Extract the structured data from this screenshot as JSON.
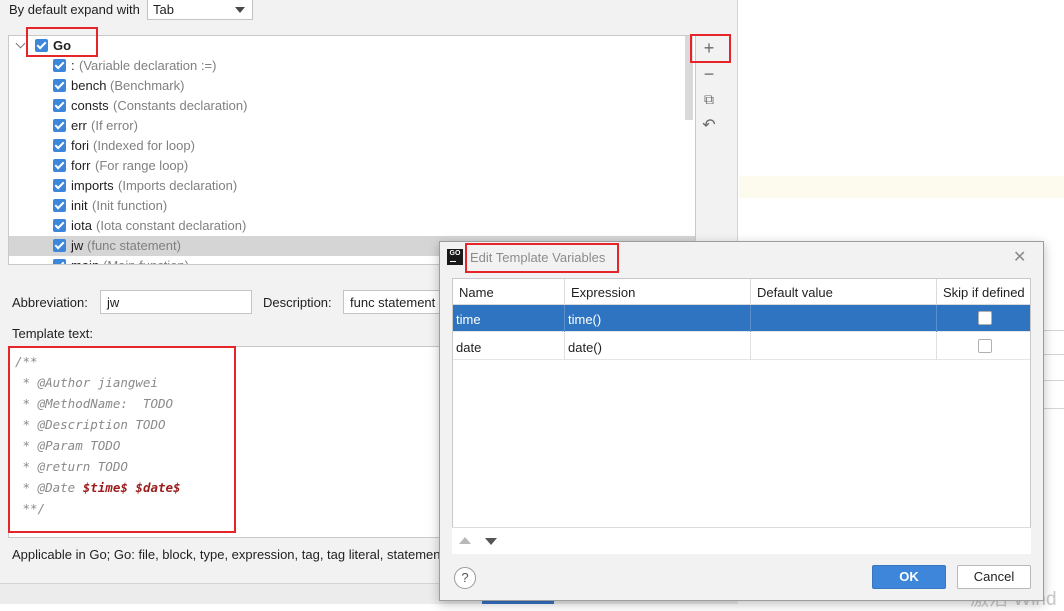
{
  "settings": {
    "expand_label": "By default expand with",
    "expand_value": "Tab",
    "group": {
      "name": "Go"
    },
    "templates": [
      {
        "abbr": ":",
        "desc": "(Variable declaration :=)"
      },
      {
        "abbr": "bench",
        "desc": "(Benchmark)"
      },
      {
        "abbr": "consts",
        "desc": "(Constants declaration)"
      },
      {
        "abbr": "err",
        "desc": "(If error)"
      },
      {
        "abbr": "fori",
        "desc": "(Indexed for loop)"
      },
      {
        "abbr": "forr",
        "desc": "(For range loop)"
      },
      {
        "abbr": "imports",
        "desc": "(Imports declaration)"
      },
      {
        "abbr": "init",
        "desc": "(Init function)"
      },
      {
        "abbr": "iota",
        "desc": "(Iota constant declaration)"
      },
      {
        "abbr": "jw",
        "desc": "(func statement)",
        "selected": true
      },
      {
        "abbr": "main",
        "desc": "(Main function)"
      }
    ],
    "toolbar": {
      "add": "+",
      "remove": "−",
      "copy": "⧉",
      "restore": "↶"
    },
    "abbreviation_label": "Abbreviation:",
    "abbreviation_value": "jw",
    "description_label": "Description:",
    "description_value": "func statement",
    "template_text_label": "Template text:",
    "template_lines": [
      "/**",
      " * @Author jiangwei",
      " * @MethodName:  TODO",
      " * @Description TODO",
      " * @Param TODO",
      " * @return TODO",
      " * @Date ",
      " **/"
    ],
    "template_vars": [
      "$time$",
      "$date$"
    ],
    "applicable_text": "Applicable in Go; Go: file, block, type, expression, tag, tag literal, statement"
  },
  "dialog": {
    "title": "Edit Template Variables",
    "close_glyph": "✕",
    "icon_text": "GO",
    "columns": [
      "Name",
      "Expression",
      "Default value",
      "Skip if defined"
    ],
    "rows": [
      {
        "name": "time",
        "expression": "time()",
        "default": "",
        "skip": false,
        "selected": true
      },
      {
        "name": "date",
        "expression": "date()",
        "default": "",
        "skip": false,
        "selected": false
      }
    ],
    "help_label": "?",
    "ok_label": "OK",
    "cancel_label": "Cancel"
  },
  "watermark": "激活 Wind",
  "colors": {
    "accent": "#3d86d9",
    "selection": "#2f74c1",
    "highlight": "#e5252a"
  }
}
